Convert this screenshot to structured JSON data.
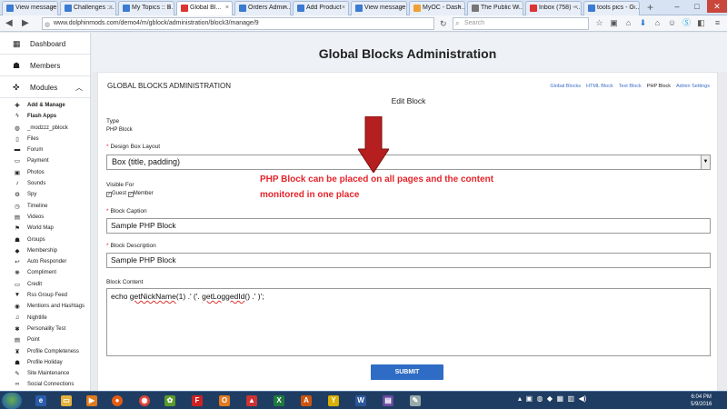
{
  "browser": {
    "tabs": [
      {
        "label": "View message",
        "color": "#3b7bd1"
      },
      {
        "label": "Challenges :...",
        "color": "#3b7bd1"
      },
      {
        "label": "My Topics :: B...",
        "color": "#3b7bd1"
      },
      {
        "label": "Global Bl...",
        "color": "#d33",
        "active": true
      },
      {
        "label": "Orders Admin...",
        "color": "#3b7bd1"
      },
      {
        "label": "Add Product",
        "color": "#3b7bd1"
      },
      {
        "label": "View message",
        "color": "#3b7bd1"
      },
      {
        "label": "MyOC - Dash...",
        "color": "#f0a030"
      },
      {
        "label": "The Public W...",
        "color": "#777"
      },
      {
        "label": "Inbox (758) - ...",
        "color": "#d33"
      },
      {
        "label": "tools pics - G...",
        "color": "#3b7bd1"
      }
    ],
    "new_tab": "+",
    "url": "www.dolphinmods.com/demo4/m/gblock/administration/block3/manage/9",
    "search_placeholder": "Search",
    "window_controls": [
      "–",
      "□",
      "✕"
    ]
  },
  "sidebar": {
    "dashboard": "Dashboard",
    "members": "Members",
    "modules": "Modules",
    "items": [
      {
        "label": "Add & Manage",
        "icon": "plus-icon",
        "glyph": "✚",
        "bold": true
      },
      {
        "label": "Flash Apps",
        "icon": "bolt-icon",
        "glyph": "ϟ",
        "bold": true
      },
      {
        "label": "_modzzz_pblock",
        "icon": "globe-icon",
        "glyph": "◍"
      },
      {
        "label": "Files",
        "icon": "file-icon",
        "glyph": "▯"
      },
      {
        "label": "Forum",
        "icon": "chat-icon",
        "glyph": "▬"
      },
      {
        "label": "Payment",
        "icon": "card-icon",
        "glyph": "▭"
      },
      {
        "label": "Photos",
        "icon": "image-icon",
        "glyph": "▣"
      },
      {
        "label": "Sounds",
        "icon": "music-icon",
        "glyph": "♪"
      },
      {
        "label": "Spy",
        "icon": "gear-icon",
        "glyph": "⚙"
      },
      {
        "label": "Timeline",
        "icon": "clock-icon",
        "glyph": "◷"
      },
      {
        "label": "Videos",
        "icon": "film-icon",
        "glyph": "▤"
      },
      {
        "label": "World Map",
        "icon": "marker-icon",
        "glyph": "⚑"
      },
      {
        "label": "Groups",
        "icon": "group-icon",
        "glyph": "☗"
      },
      {
        "label": "Membership",
        "icon": "ticket-icon",
        "glyph": "◆"
      },
      {
        "label": "Auto Responder",
        "icon": "reply-icon",
        "glyph": "↩"
      },
      {
        "label": "Compliment",
        "icon": "star-icon",
        "glyph": "❋"
      },
      {
        "label": "Credit",
        "icon": "credit-icon",
        "glyph": "▭"
      },
      {
        "label": "Rss Group Feed",
        "icon": "funnel-icon",
        "glyph": "▼"
      },
      {
        "label": "Mentions and Hashtags",
        "icon": "at-icon",
        "glyph": "◉"
      },
      {
        "label": "Nightlife",
        "icon": "music-icon",
        "glyph": "♫"
      },
      {
        "label": "Personality Test",
        "icon": "asterisk-icon",
        "glyph": "✱"
      },
      {
        "label": "Point",
        "icon": "list-icon",
        "glyph": "▤"
      },
      {
        "label": "Profile Completeness",
        "icon": "trophy-icon",
        "glyph": "♜"
      },
      {
        "label": "Profile Holiday",
        "icon": "user-icon",
        "glyph": "☗"
      },
      {
        "label": "Site Maintenance",
        "icon": "wrench-icon",
        "glyph": "✎"
      },
      {
        "label": "Social Connections",
        "icon": "link-icon",
        "glyph": "∞"
      }
    ]
  },
  "page": {
    "banner_title": "Global Blocks Administration",
    "panel_title": "GLOBAL BLOCKS ADMINISTRATION",
    "subnav": [
      {
        "label": "Global Blocks",
        "current": false
      },
      {
        "label": "HTML Block",
        "current": false
      },
      {
        "label": "Text Block",
        "current": false
      },
      {
        "label": "PHP Block",
        "current": true
      },
      {
        "label": "Admin Settings",
        "current": false
      }
    ],
    "heading": "Edit Block",
    "type_label": "Type",
    "type_value": "PHP Block",
    "layout_label": "Design Box Layout",
    "layout_value": "Box (title, padding)",
    "visible_label": "Visible For",
    "visible_guest": "Guest",
    "visible_member": "Member",
    "caption_label": "Block Caption",
    "caption_value": "Sample PHP Block",
    "description_label": "Block Description",
    "description_value": "Sample PHP Block",
    "content_label": "Block Content",
    "content_a": "echo ",
    "content_b": "getNickName",
    "content_c": "(1) .' ('. ",
    "content_d": "getLoggedId",
    "content_e": "()  .' )';",
    "submit_label": "SUBMIT",
    "required_mark": "*"
  },
  "annotation": {
    "line1": "PHP Block can be placed on all pages and the content",
    "line2": "monitored in one place",
    "color": "#e5252b"
  },
  "taskbar": {
    "time": "6:04 PM",
    "date": "5/9/2016"
  }
}
